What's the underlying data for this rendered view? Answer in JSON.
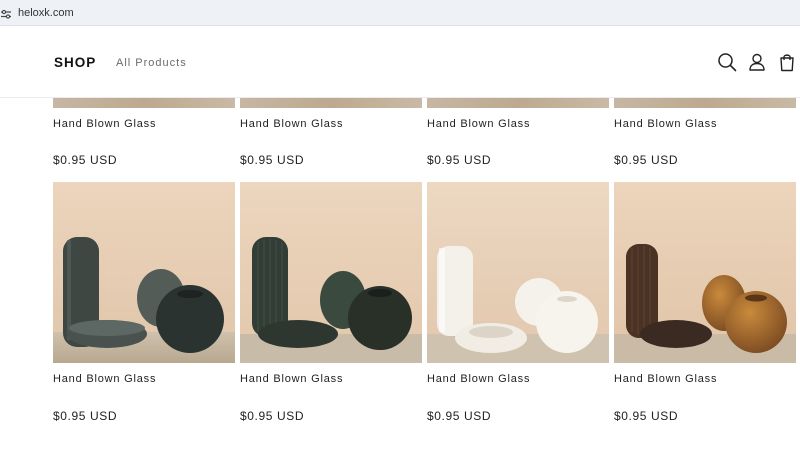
{
  "browser": {
    "url": "heloxk.com"
  },
  "header": {
    "logo": "SHOP",
    "nav": [
      "All Products"
    ],
    "icons": [
      "search-icon",
      "account-icon",
      "cart-icon"
    ]
  },
  "products_row1": [
    {
      "title": "Hand Blown Glass",
      "price": "$0.95 USD"
    },
    {
      "title": "Hand Blown Glass",
      "price": "$0.95 USD"
    },
    {
      "title": "Hand Blown Glass",
      "price": "$0.95 USD"
    },
    {
      "title": "Hand Blown Glass",
      "price": "$0.95 USD"
    }
  ],
  "products_row2": [
    {
      "title": "Hand Blown Glass",
      "price": "$0.95 USD",
      "image": "dark green smoke glass vases",
      "glass_color": "#3d4743"
    },
    {
      "title": "Hand Blown Glass",
      "price": "$0.95 USD",
      "image": "dark green ribbed glass vases",
      "glass_color": "#2f3a32"
    },
    {
      "title": "Hand Blown Glass",
      "price": "$0.95 USD",
      "image": "white matte vases",
      "glass_color": "#f4f1ea"
    },
    {
      "title": "Hand Blown Glass",
      "price": "$0.95 USD",
      "image": "amber brown ribbed glass vases",
      "glass_color": "#7a4a22"
    }
  ]
}
